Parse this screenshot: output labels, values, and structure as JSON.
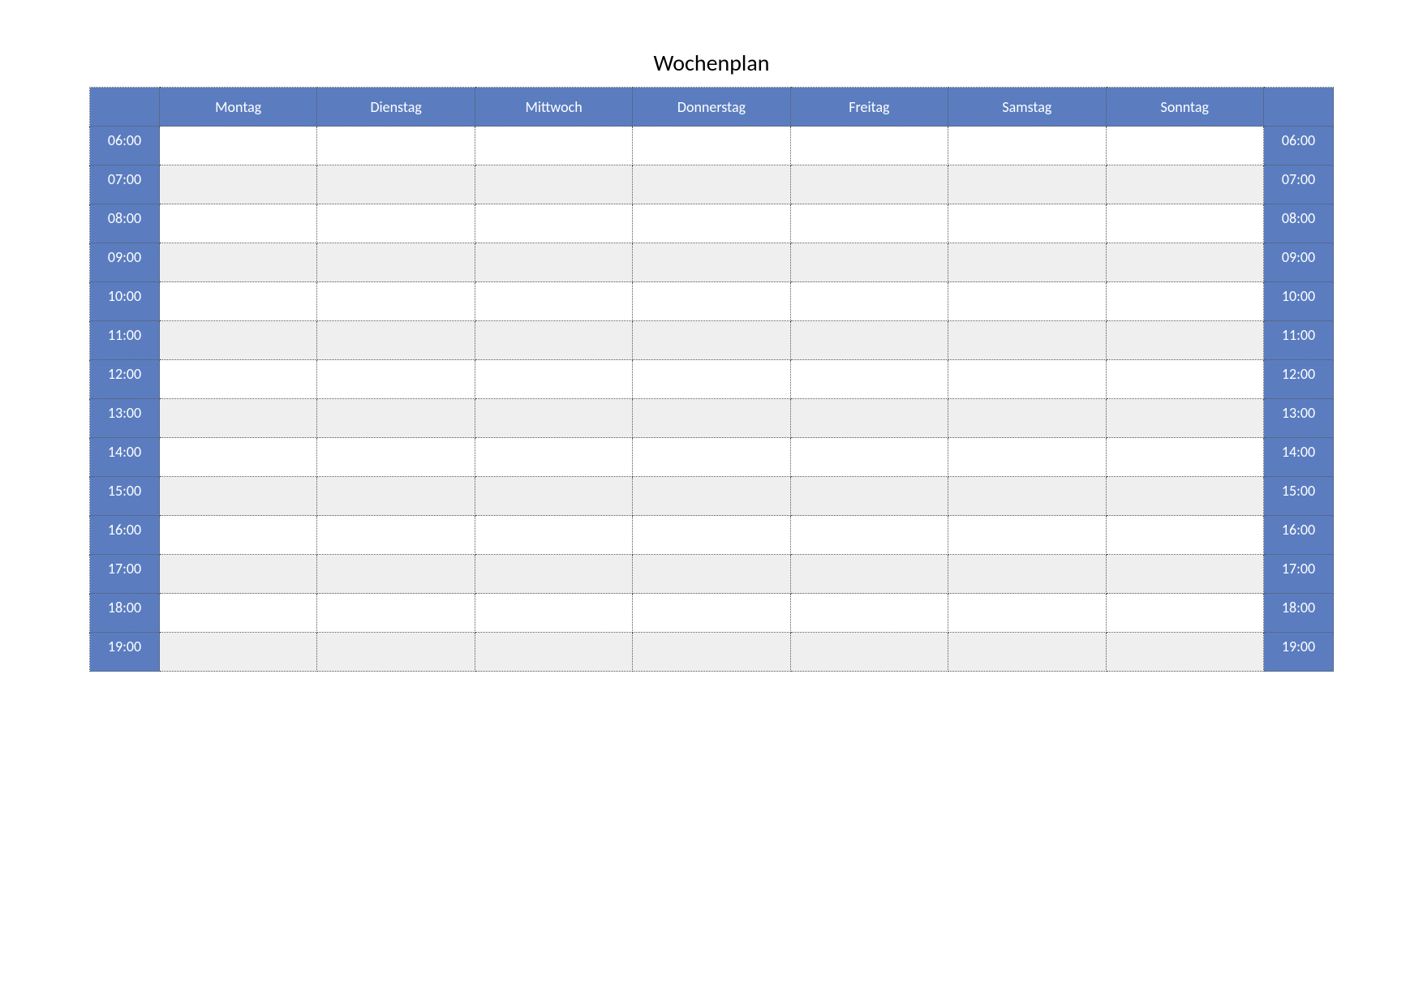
{
  "title": "Wochenplan",
  "days": [
    "Montag",
    "Dienstag",
    "Mittwoch",
    "Donnerstag",
    "Freitag",
    "Samstag",
    "Sonntag"
  ],
  "times": [
    "06:00",
    "07:00",
    "08:00",
    "09:00",
    "10:00",
    "11:00",
    "12:00",
    "13:00",
    "14:00",
    "15:00",
    "16:00",
    "17:00",
    "18:00",
    "19:00"
  ],
  "chart_data": {
    "type": "table",
    "title": "Wochenplan",
    "columns": [
      "",
      "Montag",
      "Dienstag",
      "Mittwoch",
      "Donnerstag",
      "Freitag",
      "Samstag",
      "Sonntag",
      ""
    ],
    "row_labels": [
      "06:00",
      "07:00",
      "08:00",
      "09:00",
      "10:00",
      "11:00",
      "12:00",
      "13:00",
      "14:00",
      "15:00",
      "16:00",
      "17:00",
      "18:00",
      "19:00"
    ],
    "cells": [
      [
        "",
        "",
        "",
        "",
        "",
        "",
        ""
      ],
      [
        "",
        "",
        "",
        "",
        "",
        "",
        ""
      ],
      [
        "",
        "",
        "",
        "",
        "",
        "",
        ""
      ],
      [
        "",
        "",
        "",
        "",
        "",
        "",
        ""
      ],
      [
        "",
        "",
        "",
        "",
        "",
        "",
        ""
      ],
      [
        "",
        "",
        "",
        "",
        "",
        "",
        ""
      ],
      [
        "",
        "",
        "",
        "",
        "",
        "",
        ""
      ],
      [
        "",
        "",
        "",
        "",
        "",
        "",
        ""
      ],
      [
        "",
        "",
        "",
        "",
        "",
        "",
        ""
      ],
      [
        "",
        "",
        "",
        "",
        "",
        "",
        ""
      ],
      [
        "",
        "",
        "",
        "",
        "",
        "",
        ""
      ],
      [
        "",
        "",
        "",
        "",
        "",
        "",
        ""
      ],
      [
        "",
        "",
        "",
        "",
        "",
        "",
        ""
      ],
      [
        "",
        "",
        "",
        "",
        "",
        "",
        ""
      ]
    ]
  }
}
